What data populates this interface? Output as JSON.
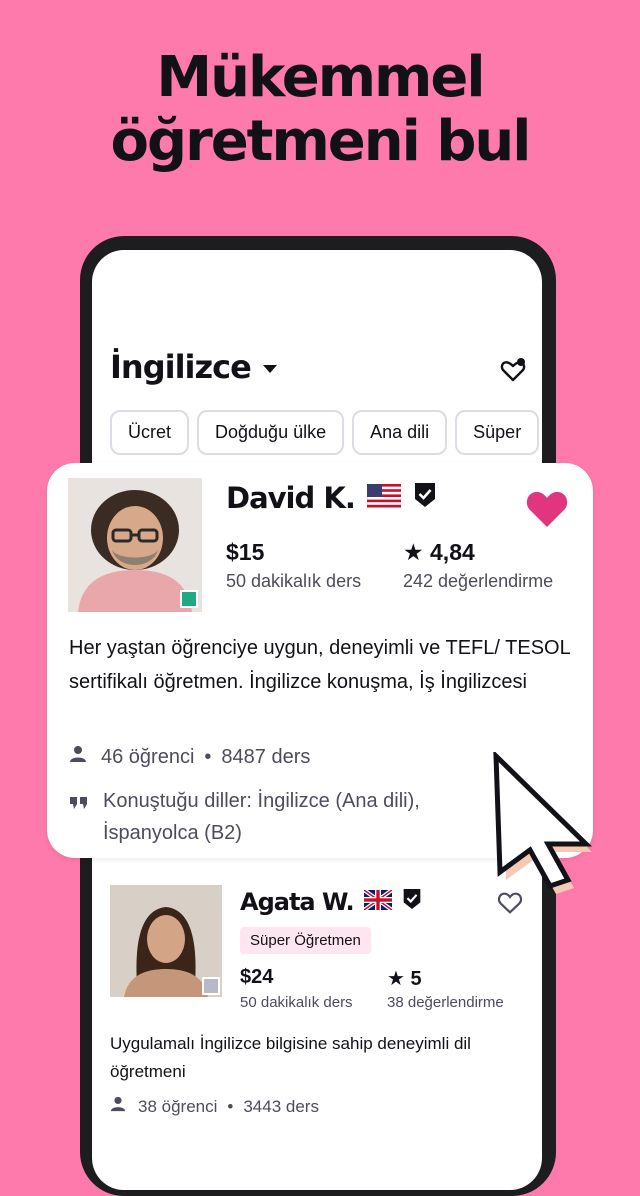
{
  "headline": [
    "Mükemmel",
    "öğretmeni bul"
  ],
  "app": {
    "language_label": "İngilizce",
    "filters": [
      "Ücret",
      "Doğduğu ülke",
      "Ana dili",
      "Süper"
    ]
  },
  "tutors": [
    {
      "name": "David K.",
      "country_flag": "us-flag-icon",
      "verified": true,
      "favorited": true,
      "price": "$15",
      "lesson_length": "50 dakikalık ders",
      "rating": "4,84",
      "reviews": "242 değerlendirme",
      "description": "Her yaştan öğrenciye uygun, deneyimli ve TEFL/ TESOL sertifikalı öğretmen. İngilizce konuşma, İş İngilizcesi",
      "students": "46 öğrenci",
      "lessons": "8487 ders",
      "languages": "Konuştuğu diller: İngilizce (Ana dili), İspanyolca (B2)",
      "online": true
    },
    {
      "name": "Agata W.",
      "country_flag": "uk-flag-icon",
      "verified": true,
      "favorited": false,
      "badge": "Süper Öğretmen",
      "price": "$24",
      "lesson_length": "50 dakikalık ders",
      "rating": "5",
      "reviews": "38 değerlendirme",
      "description": "Uygulamalı İngilizce bilgisine sahip deneyimli dil öğretmeni",
      "students": "38 öğrenci",
      "lessons": "3443 ders",
      "online": false
    }
  ],
  "colors": {
    "background": "#ff7aac",
    "accent_heart": "#e2357f",
    "online": "#1eaa82",
    "badge_bg": "#ffe5ef"
  }
}
